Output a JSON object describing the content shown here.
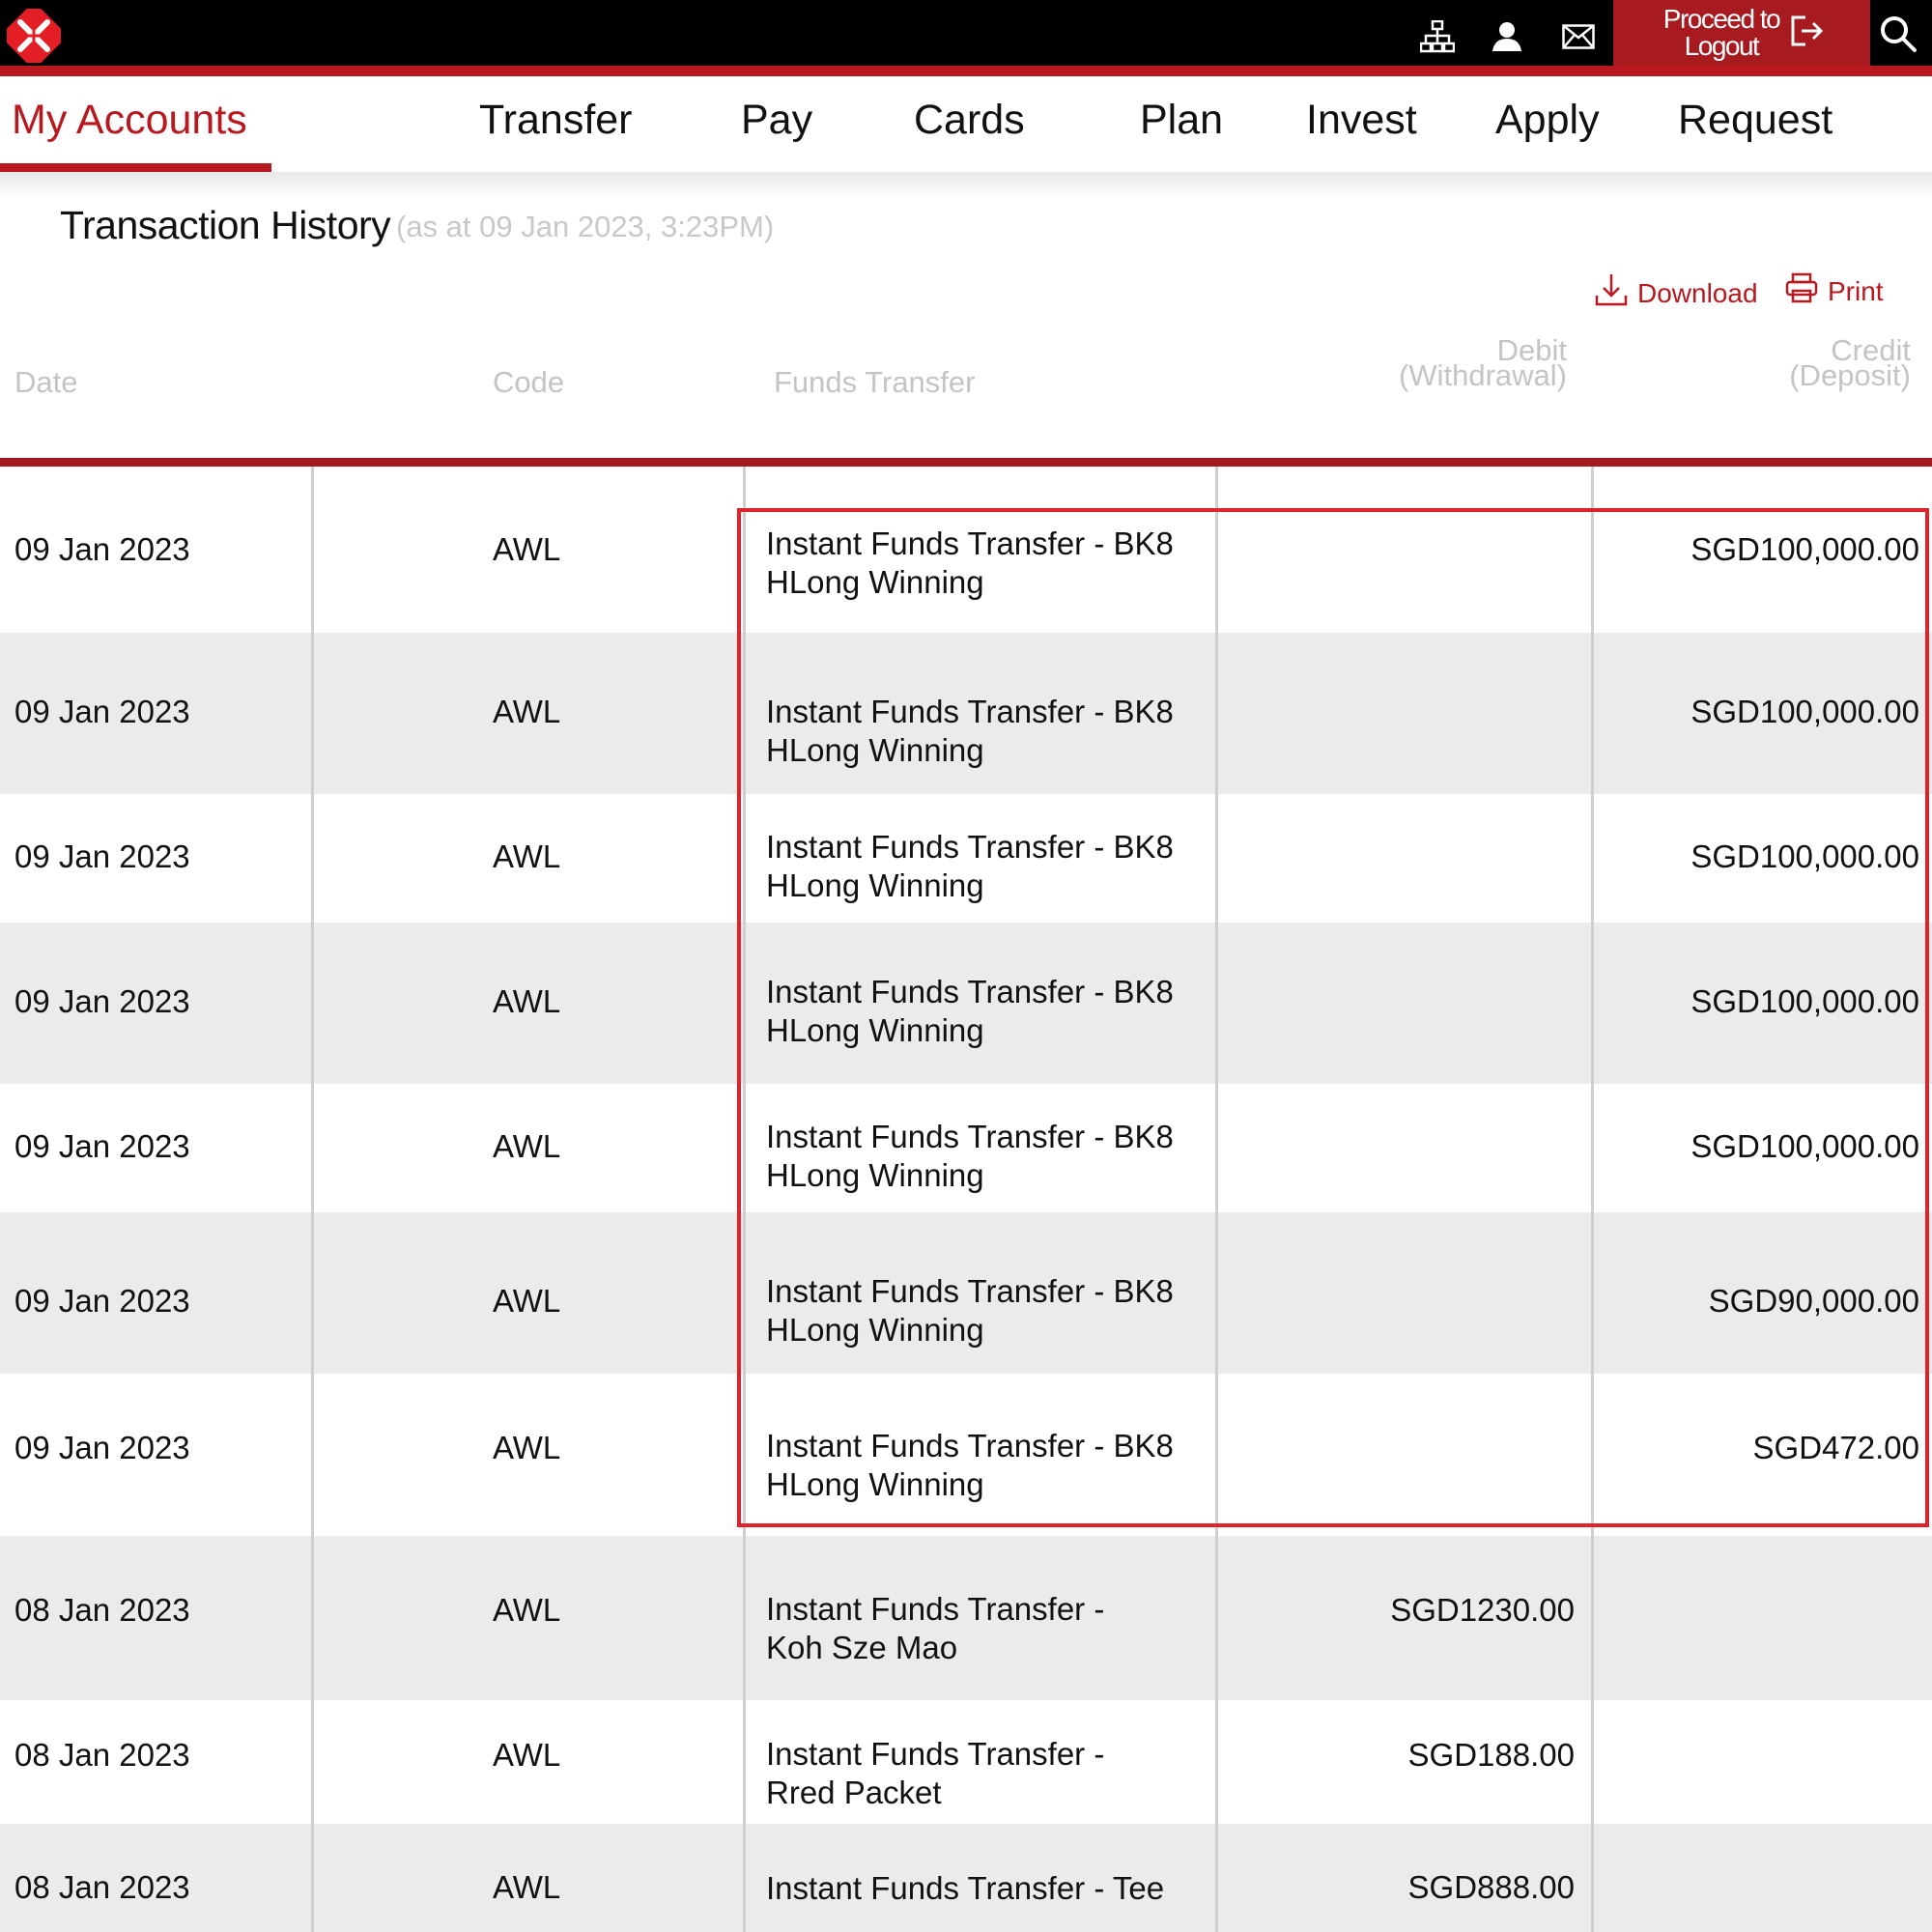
{
  "topbar": {
    "icons": [
      "sitemap-icon",
      "user-icon",
      "mail-icon",
      "logout-icon",
      "search-icon"
    ],
    "logout_line1": "Proceed to",
    "logout_line2": "Logout"
  },
  "nav": {
    "items": [
      {
        "label": "My Accounts",
        "active": true
      },
      {
        "label": "Transfer"
      },
      {
        "label": "Pay"
      },
      {
        "label": "Cards"
      },
      {
        "label": "Plan"
      },
      {
        "label": "Invest"
      },
      {
        "label": "Apply"
      },
      {
        "label": "Request"
      }
    ]
  },
  "page": {
    "title": "Transaction History",
    "subtitle": "(as at 09 Jan 2023, 3:23PM)",
    "download_label": "Download",
    "print_label": "Print"
  },
  "table": {
    "headers": {
      "date": "Date",
      "code": "Code",
      "description": "Funds Transfer",
      "debit_line1": "Debit",
      "debit_line2": "(Withdrawal)",
      "credit_line1": "Credit",
      "credit_line2": "(Deposit)"
    },
    "rows": [
      {
        "date": "09 Jan 2023",
        "code": "AWL",
        "desc1": "Instant Funds Transfer - BK8",
        "desc2": "HLong Winning",
        "debit": "",
        "credit": "SGD100,000.00"
      },
      {
        "date": "09 Jan 2023",
        "code": "AWL",
        "desc1": "Instant Funds Transfer - BK8",
        "desc2": "HLong Winning",
        "debit": "",
        "credit": "SGD100,000.00"
      },
      {
        "date": "09 Jan 2023",
        "code": "AWL",
        "desc1": "Instant Funds Transfer - BK8",
        "desc2": "HLong Winning",
        "debit": "",
        "credit": "SGD100,000.00"
      },
      {
        "date": "09 Jan 2023",
        "code": "AWL",
        "desc1": "Instant Funds Transfer - BK8",
        "desc2": "HLong Winning",
        "debit": "",
        "credit": "SGD100,000.00"
      },
      {
        "date": "09 Jan 2023",
        "code": "AWL",
        "desc1": "Instant Funds Transfer - BK8",
        "desc2": "HLong Winning",
        "debit": "",
        "credit": "SGD100,000.00"
      },
      {
        "date": "09 Jan 2023",
        "code": "AWL",
        "desc1": "Instant Funds Transfer - BK8",
        "desc2": "HLong Winning",
        "debit": "",
        "credit": "SGD90,000.00"
      },
      {
        "date": "09 Jan 2023",
        "code": "AWL",
        "desc1": "Instant Funds Transfer - BK8",
        "desc2": "HLong Winning",
        "debit": "",
        "credit": "SGD472.00"
      },
      {
        "date": "08 Jan 2023",
        "code": "AWL",
        "desc1": "Instant Funds Transfer -",
        "desc2": "Koh Sze Mao",
        "debit": "SGD1230.00",
        "credit": ""
      },
      {
        "date": "08 Jan 2023",
        "code": "AWL",
        "desc1": "Instant Funds Transfer -",
        "desc2": "Rred Packet",
        "debit": "SGD188.00",
        "credit": ""
      },
      {
        "date": "08 Jan 2023",
        "code": "AWL",
        "desc1": "Instant Funds Transfer - Tee",
        "desc2": "",
        "debit": "SGD888.00",
        "credit": ""
      }
    ]
  },
  "colors": {
    "brand_red": "#b8191f",
    "logout_bg": "#a71a1f",
    "highlight_border": "#e0232a",
    "row_shade": "#ebebeb"
  }
}
